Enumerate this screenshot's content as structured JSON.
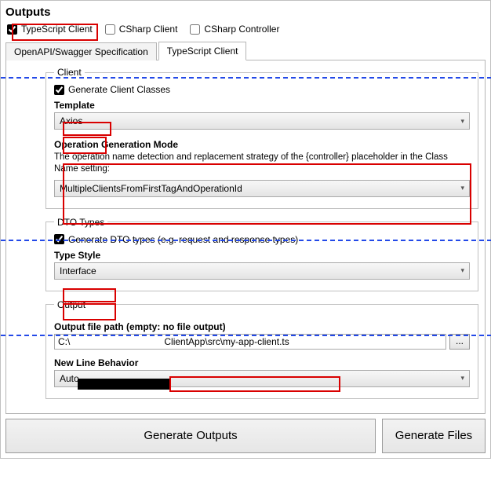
{
  "section_title": "Outputs",
  "checkboxes": {
    "ts_client": "TypeScript Client",
    "csharp_client": "CSharp Client",
    "csharp_controller": "CSharp Controller"
  },
  "tabs": {
    "swagger": "OpenAPI/Swagger Specification",
    "ts": "TypeScript Client"
  },
  "client_group": {
    "legend": "Client",
    "gen_classes": "Generate Client Classes",
    "template_label": "Template",
    "template_value": "Axios",
    "opgen_label": "Operation Generation Mode",
    "opgen_desc": "The operation name detection and replacement strategy of the {controller} placeholder in the Class Name setting:",
    "opgen_value": "MultipleClientsFromFirstTagAndOperationId"
  },
  "dto_group": {
    "legend": "DTO Types",
    "gen_dto": "Generate DTO types (e.g. request and response types)",
    "typestyle_label": "Type Style",
    "typestyle_value": "Interface"
  },
  "output_group": {
    "legend": "Output",
    "path_label": "Output file path (empty: no file output)",
    "path_value": "C:\\                                    ClientApp\\src\\my-app-client.ts",
    "browse_label": "...",
    "newline_label": "New Line Behavior",
    "newline_value": "Auto"
  },
  "buttons": {
    "gen_outputs": "Generate Outputs",
    "gen_files": "Generate Files"
  }
}
